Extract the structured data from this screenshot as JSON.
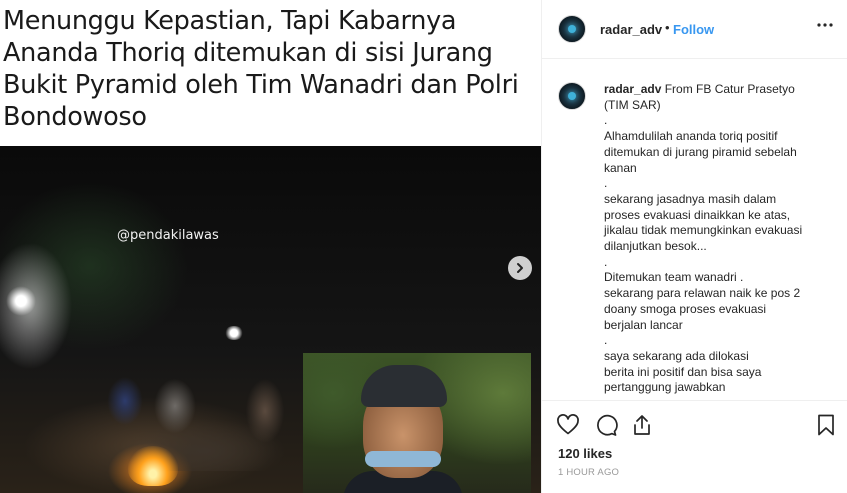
{
  "media": {
    "headline": "Menunggu Kepastian, Tapi Kabarnya Ananda Thoriq ditemukan di sisi Jurang Bukit Pyramid oleh Tim Wanadri dan Polri Bondowoso",
    "watermark": "@pendakilawas",
    "next_icon": "chevron-right-icon"
  },
  "header": {
    "username": "radar_adv",
    "separator": "•",
    "follow_label": "Follow",
    "more_icon": "more-horizontal-icon"
  },
  "caption": {
    "username": "radar_adv",
    "lines": [
      "From FB Catur Prasetyo",
      "(TIM SAR)",
      ".",
      "Alhamdulilah ananda toriq positif",
      "ditemukan di jurang piramid sebelah",
      "kanan",
      ".",
      "sekarang jasadnya masih dalam",
      "proses evakuasi dinaikkan ke atas,",
      "jikalau tidak memungkinkan evakuasi",
      "dilanjutkan besok...",
      ".",
      "Ditemukan team wanadri .",
      "sekarang para relawan naik ke pos 2",
      "doany smoga proses evakuasi",
      "berjalan lancar",
      ".",
      "saya sekarang ada dilokasi",
      "berita ini positif dan bisa saya",
      "pertanggung jawabkan"
    ]
  },
  "actions": {
    "like_icon": "heart-icon",
    "comment_icon": "comment-icon",
    "share_icon": "share-icon",
    "save_icon": "bookmark-icon",
    "likes_text": "120 likes",
    "timestamp": "1 HOUR AGO"
  },
  "colors": {
    "follow": "#3897f0",
    "text": "#262626",
    "muted": "#999999",
    "border": "#efefef"
  }
}
